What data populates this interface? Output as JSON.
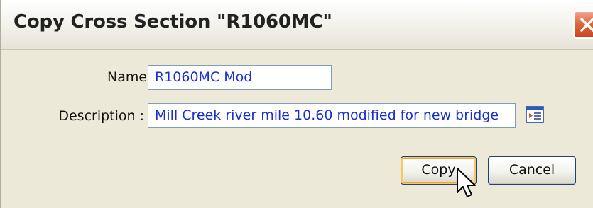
{
  "dialog": {
    "title": "Copy Cross Section \"R1060MC\"",
    "close_icon": "close-icon"
  },
  "form": {
    "name_label": "Name :",
    "name_value": "R1060MC Mod",
    "description_label": "Description :",
    "description_value": "Mill Creek river mile 10.60 modified for new bridge",
    "browse_icon": "description-editor-icon"
  },
  "buttons": {
    "copy_label": "Copy",
    "cancel_label": "Cancel"
  },
  "colors": {
    "field_text": "#1a2fd0",
    "close_button": "#e0663f",
    "default_button_focus": "#f7c860"
  }
}
